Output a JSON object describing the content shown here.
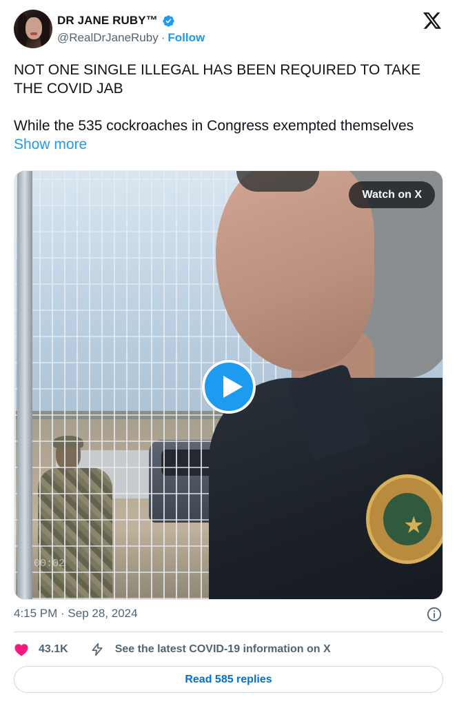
{
  "author": {
    "display_name": "DR JANE RUBY™",
    "handle": "@RealDrJaneRuby",
    "separator": "·",
    "follow_label": "Follow",
    "verified_icon": "verified-badge-icon",
    "avatar": "avatar-photo"
  },
  "tweet": {
    "paragraph_1": "NOT ONE SINGLE ILLEGAL HAS BEEN REQUIRED TO TAKE THE COVID JAB",
    "paragraph_2": "While the 535 cockroaches in Congress exempted themselves",
    "show_more_label": "Show more"
  },
  "media": {
    "watch_label": "Watch on X",
    "play_icon": "play-icon",
    "overlay_time": "00:02"
  },
  "footer": {
    "timestamp": "4:15 PM · Sep 28, 2024",
    "like_count": "43.1K",
    "covid_info_label": "See the latest COVID-19 information on X",
    "read_replies_label": "Read 585 replies"
  },
  "colors": {
    "accent": "#1d9bf0",
    "like_pink": "#f91880",
    "text_secondary": "#536471"
  }
}
